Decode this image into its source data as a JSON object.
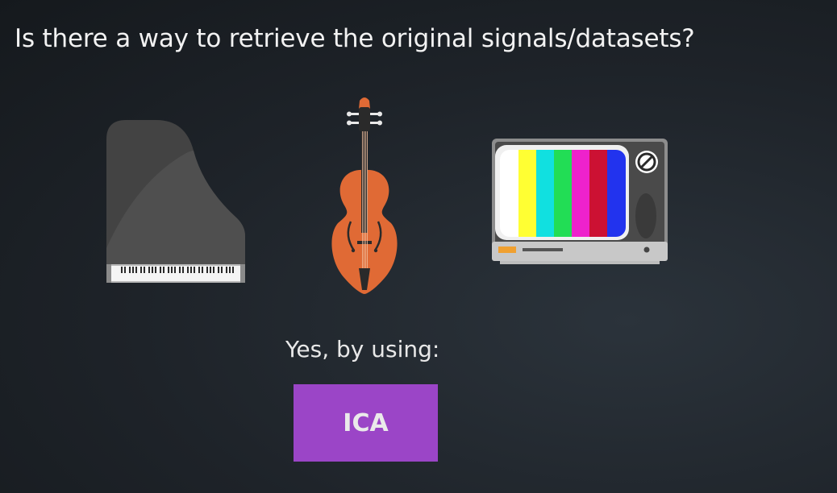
{
  "slide": {
    "question": "Is there a way to retrieve the original signals/datasets?",
    "answer": "Yes, by using:",
    "method_label": "ICA"
  },
  "illustrations": {
    "items": [
      "piano-icon",
      "violin-icon",
      "television-icon"
    ]
  },
  "colors": {
    "background": "#1e2329",
    "button": "#9b45c7",
    "violin": "#e06a35",
    "piano": "#434343",
    "tv_bars": [
      "#ffffff",
      "#ffff33",
      "#11e0e0",
      "#22dd55",
      "#ee22cc",
      "#cc1133",
      "#2233ee"
    ]
  }
}
